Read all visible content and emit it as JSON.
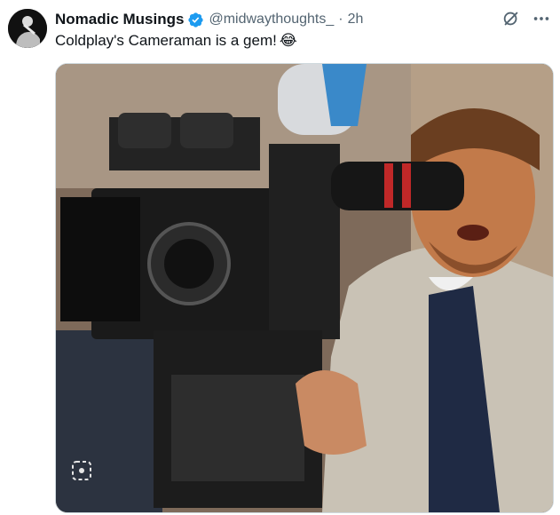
{
  "tweet": {
    "display_name": "Nomadic Musings",
    "handle": "@midwaythoughts_",
    "separator": "·",
    "time": "2h",
    "text": "Coldplay's Cameraman is a gem!",
    "emoji": "😂",
    "verified": true
  },
  "icons": {
    "avatar": "avatar-image",
    "verified": "verified-badge-icon",
    "grok": "grok-icon",
    "more": "more-options-icon"
  },
  "colors": {
    "verified_blue": "#1d9bf0",
    "secondary_text": "#536471",
    "primary_text": "#0f1419"
  }
}
